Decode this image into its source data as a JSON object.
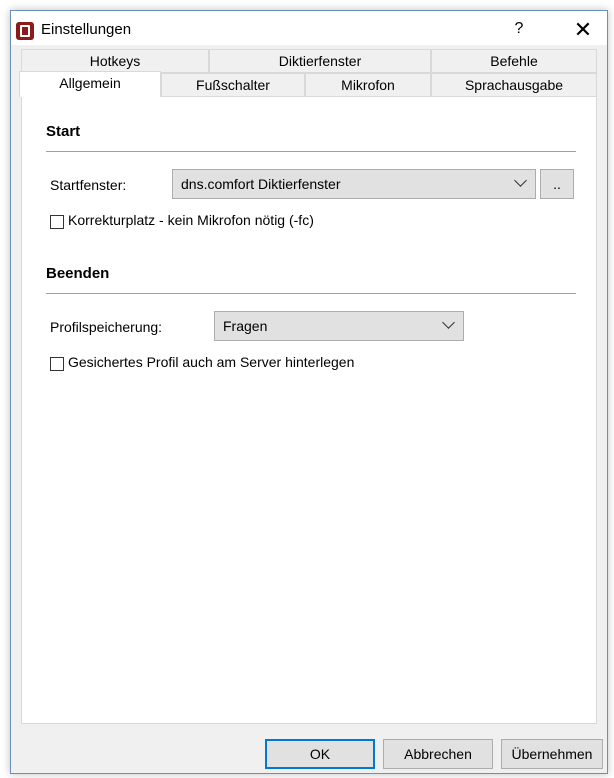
{
  "window": {
    "title": "Einstellungen",
    "help": "?",
    "close": "✕"
  },
  "tabs": {
    "row_back": [
      "Hotkeys",
      "Diktierfenster",
      "Befehle"
    ],
    "row_front": [
      "Allgemein",
      "Fußschalter",
      "Mikrofon",
      "Sprachausgabe"
    ],
    "active": "Allgemein"
  },
  "start": {
    "title": "Start",
    "startfenster_label": "Startfenster:",
    "startfenster_value": "dns.comfort Diktierfenster",
    "browse_label": "..",
    "korrektur_label": "Korrekturplatz - kein Mikrofon nötig (-fc)",
    "korrektur_checked": false
  },
  "beenden": {
    "title": "Beenden",
    "profil_label": "Profilspeicherung:",
    "profil_value": "Fragen",
    "server_label": "Gesichertes Profil auch am Server hinterlegen",
    "server_checked": false
  },
  "buttons": {
    "ok": "OK",
    "cancel": "Abbrechen",
    "apply": "Übernehmen"
  },
  "colors": {
    "accent": "#0078d7",
    "icon": "#8b1a1a"
  }
}
